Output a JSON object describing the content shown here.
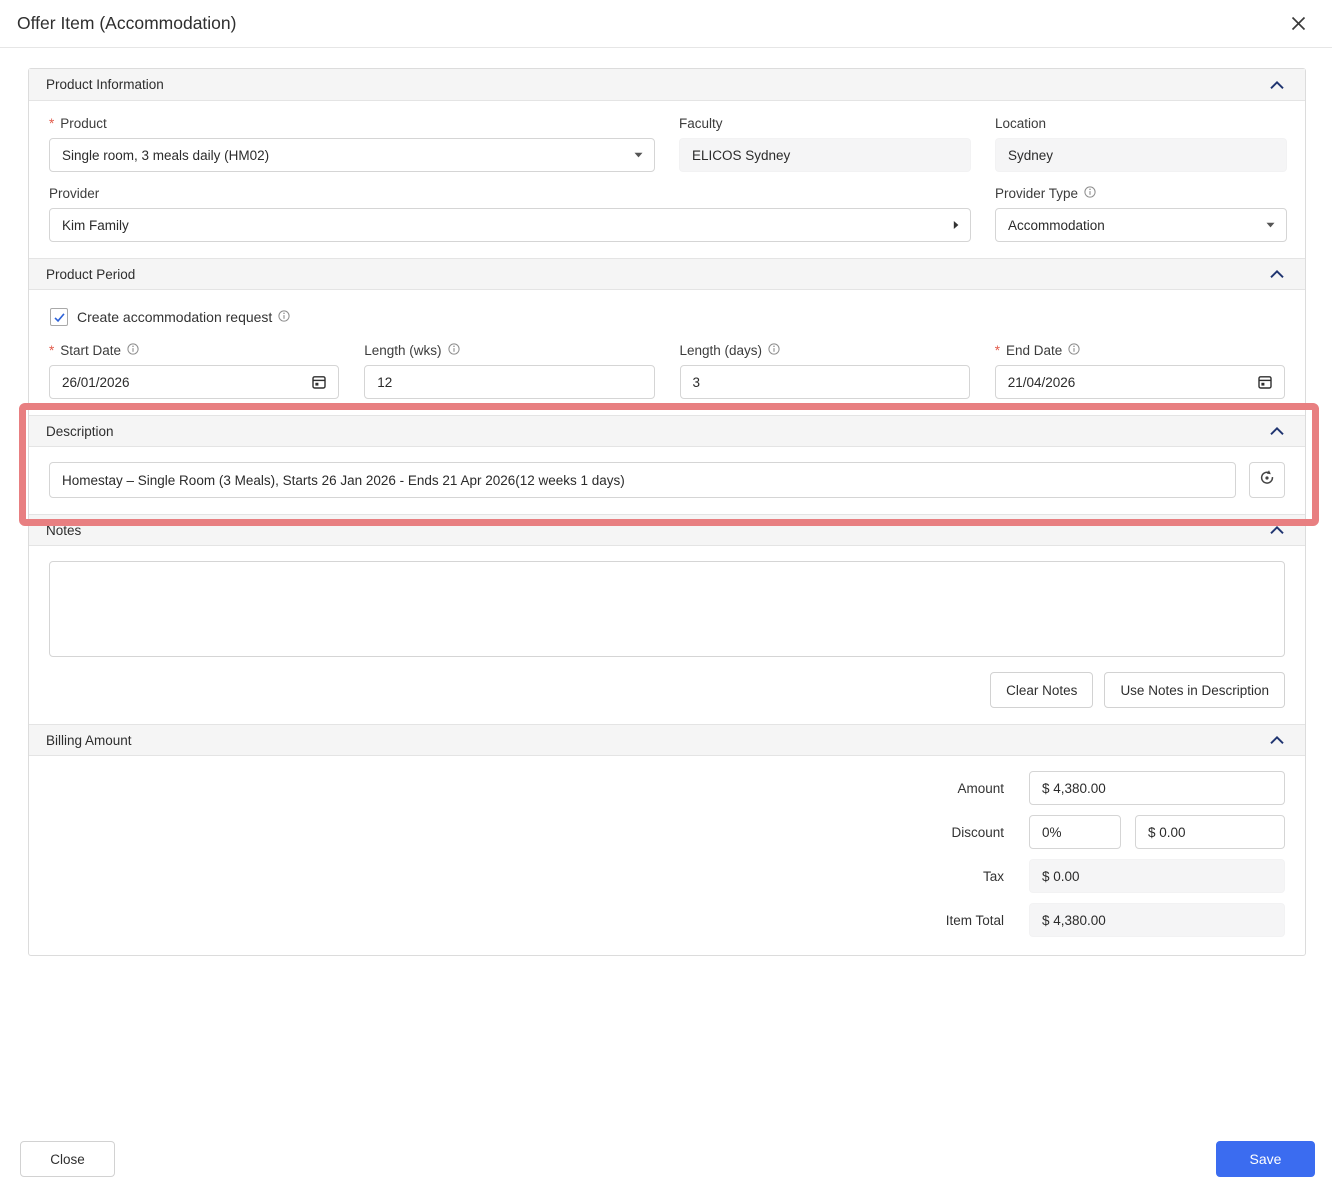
{
  "misc": {
    "required_mark": "*"
  },
  "dialog": {
    "title": "Offer Item (Accommodation)"
  },
  "icons": {
    "close": "x-icon",
    "collapse": "chevron-up-icon",
    "dropdown": "caret-down-icon",
    "expand_right": "caret-right-icon",
    "calendar": "calendar-icon",
    "info": "info-icon",
    "reset": "reset-icon"
  },
  "colors": {
    "accent_blue": "#3b6cf0",
    "highlight_red": "#e87f81",
    "chevron_navy": "#1f3470",
    "header_gray": "#f5f5f5"
  },
  "product_information": {
    "header": "Product Information",
    "product": {
      "label": "Product",
      "value": "Single room, 3 meals daily (HM02)"
    },
    "faculty": {
      "label": "Faculty",
      "value": "ELICOS Sydney"
    },
    "location": {
      "label": "Location",
      "value": "Sydney"
    },
    "provider": {
      "label": "Provider",
      "value": "Kim Family"
    },
    "provider_type": {
      "label": "Provider Type",
      "value": "Accommodation"
    }
  },
  "product_period": {
    "header": "Product Period",
    "create_request": {
      "label": "Create accommodation request",
      "checked": true
    },
    "start_date": {
      "label": "Start Date",
      "value": "26/01/2026"
    },
    "length_wks": {
      "label": "Length (wks)",
      "value": "12"
    },
    "length_days": {
      "label": "Length (days)",
      "value": "3"
    },
    "end_date": {
      "label": "End Date",
      "value": "21/04/2026"
    }
  },
  "description": {
    "header": "Description",
    "value": "Homestay – Single Room (3 Meals), Starts 26 Jan 2026 - Ends 21 Apr 2026(12 weeks 1 days)"
  },
  "notes": {
    "header": "Notes",
    "value": "",
    "clear_button": "Clear Notes",
    "use_button": "Use Notes in Description"
  },
  "billing": {
    "header": "Billing Amount",
    "amount": {
      "label": "Amount",
      "value": "$ 4,380.00"
    },
    "discount": {
      "label": "Discount",
      "percent": "0%",
      "value": "$ 0.00"
    },
    "tax": {
      "label": "Tax",
      "value": "$ 0.00"
    },
    "item_total": {
      "label": "Item Total",
      "value": "$ 4,380.00"
    }
  },
  "footer": {
    "close_label": "Close",
    "save_label": "Save"
  }
}
